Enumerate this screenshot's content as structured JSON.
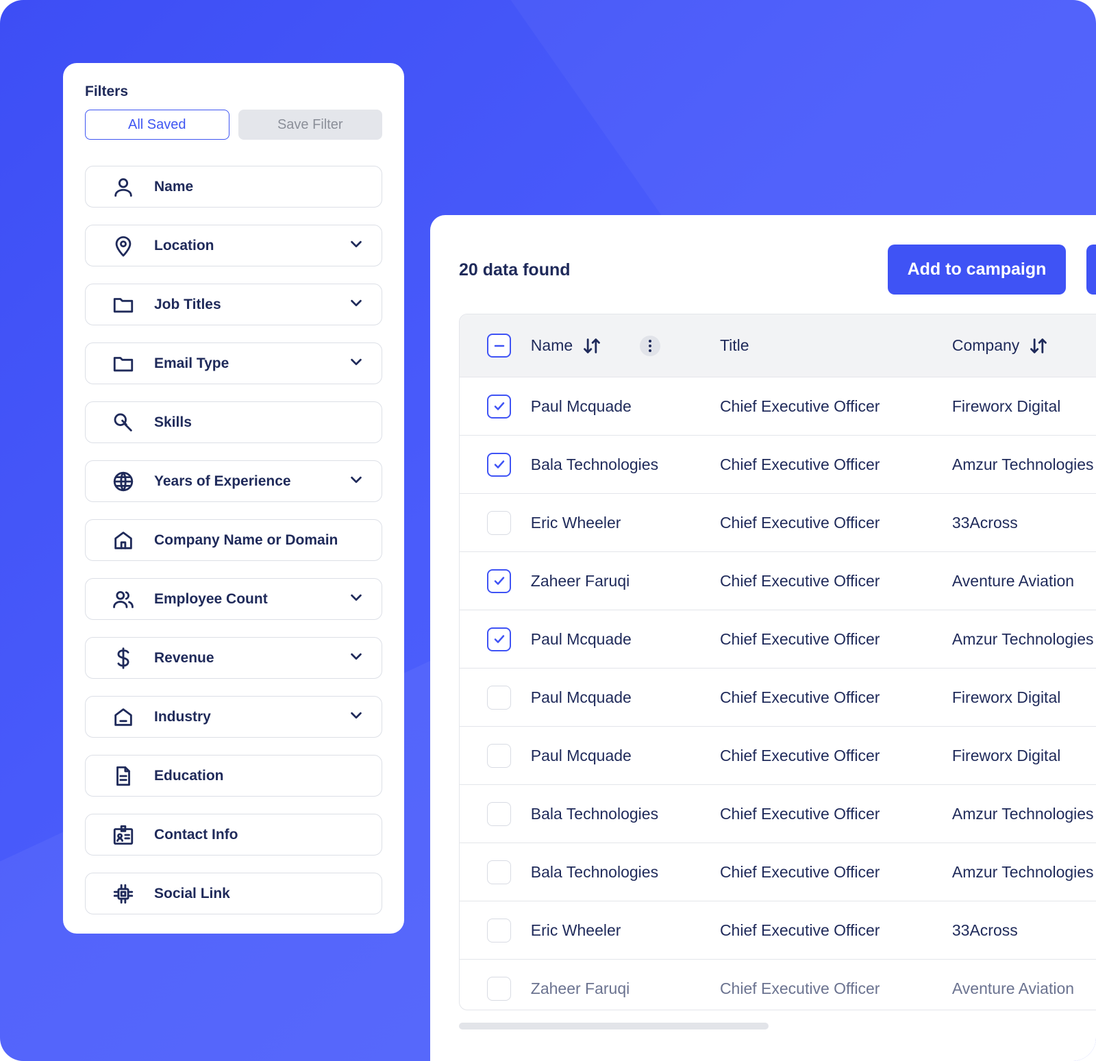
{
  "filters": {
    "title": "Filters",
    "all_saved": "All Saved",
    "save_filter": "Save Filter",
    "items": [
      {
        "label": "Name",
        "icon": "user-icon",
        "dropdown": false
      },
      {
        "label": "Location",
        "icon": "location-pin-icon",
        "dropdown": true
      },
      {
        "label": "Job Titles",
        "icon": "folder-icon",
        "dropdown": true
      },
      {
        "label": "Email Type",
        "icon": "folder-icon",
        "dropdown": true
      },
      {
        "label": "Skills",
        "icon": "search-icon",
        "dropdown": false
      },
      {
        "label": "Years of Experience",
        "icon": "globe-icon",
        "dropdown": true
      },
      {
        "label": "Company Name or Domain",
        "icon": "home-icon",
        "dropdown": false
      },
      {
        "label": "Employee Count",
        "icon": "users-icon",
        "dropdown": true
      },
      {
        "label": "Revenue",
        "icon": "dollar-icon",
        "dropdown": true
      },
      {
        "label": "Industry",
        "icon": "inbox-icon",
        "dropdown": true
      },
      {
        "label": "Education",
        "icon": "document-icon",
        "dropdown": false
      },
      {
        "label": "Contact Info",
        "icon": "contact-card-icon",
        "dropdown": false
      },
      {
        "label": "Social Link",
        "icon": "chip-icon",
        "dropdown": false
      }
    ]
  },
  "results": {
    "count": "20 data found",
    "add_to_campaign": "Add to campaign",
    "columns": {
      "name": "Name",
      "title": "Title",
      "company": "Company"
    },
    "rows": [
      {
        "name": "Paul Mcquade",
        "title": "Chief Executive Officer",
        "company": "Fireworx Digital",
        "checked": true
      },
      {
        "name": "Bala Technologies",
        "title": "Chief Executive Officer",
        "company": "Amzur Technologies",
        "checked": true
      },
      {
        "name": "Eric Wheeler",
        "title": "Chief Executive Officer",
        "company": "33Across",
        "checked": false
      },
      {
        "name": "Zaheer Faruqi",
        "title": "Chief Executive Officer",
        "company": "Aventure Aviation",
        "checked": true
      },
      {
        "name": "Paul Mcquade",
        "title": "Chief Executive Officer",
        "company": "Amzur Technologies",
        "checked": true
      },
      {
        "name": "Paul Mcquade",
        "title": "Chief Executive Officer",
        "company": "Fireworx Digital",
        "checked": false
      },
      {
        "name": "Paul Mcquade",
        "title": "Chief Executive Officer",
        "company": "Fireworx Digital",
        "checked": false
      },
      {
        "name": "Bala Technologies",
        "title": "Chief Executive Officer",
        "company": "Amzur Technologies",
        "checked": false
      },
      {
        "name": "Bala Technologies",
        "title": "Chief Executive Officer",
        "company": "Amzur Technologies",
        "checked": false
      },
      {
        "name": "Eric Wheeler",
        "title": "Chief Executive Officer",
        "company": "33Across",
        "checked": false
      },
      {
        "name": "Zaheer Faruqi",
        "title": "Chief Executive Officer",
        "company": "Aventure Aviation",
        "checked": false
      }
    ]
  },
  "colors": {
    "accent": "#3f53f5",
    "text": "#1f2a5a",
    "background": "#4352f8"
  }
}
